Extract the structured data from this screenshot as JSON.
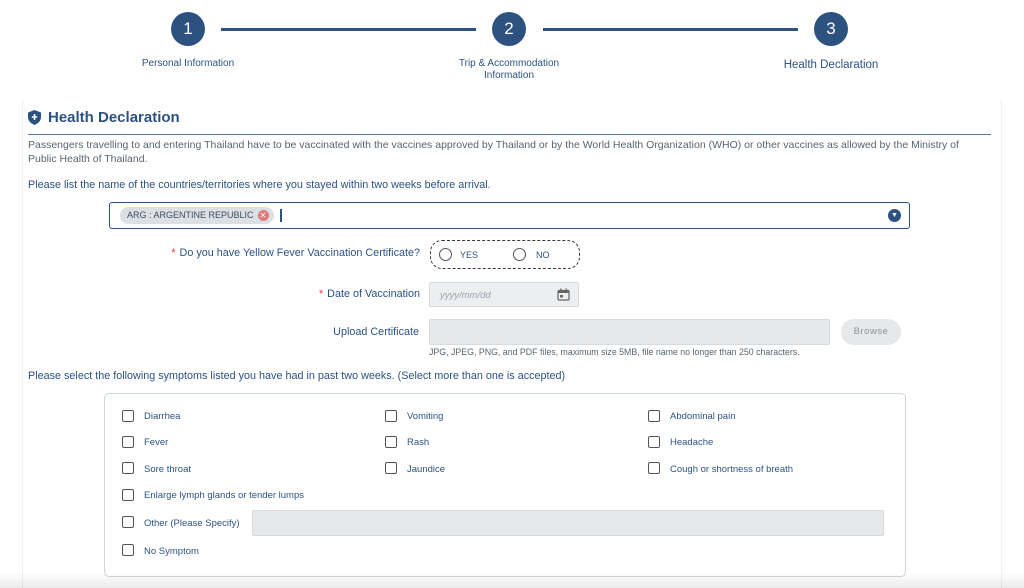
{
  "stepper": {
    "steps": [
      {
        "number": "1",
        "label": "Personal Information"
      },
      {
        "number": "2",
        "label_line1": "Trip & Accommodation",
        "label_line2": "Information"
      },
      {
        "number": "3",
        "label": "Health Declaration"
      }
    ],
    "active_step": 3
  },
  "section": {
    "icon": "shield-icon",
    "title": "Health Declaration",
    "intro": "Passengers travelling to and entering Thailand have to be vaccinated with the vaccines approved by Thailand or by the World Health Organization (WHO) or other vaccines as allowed by the Ministry of Public Health of Thailand."
  },
  "countries": {
    "question": "Please list the name of the countries/territories where you stayed within two weeks before arrival.",
    "selected": [
      "ARG : ARGENTINE REPUBLIC"
    ]
  },
  "yellow_fever": {
    "required_mark": "*",
    "question": "Do you have Yellow Fever Vaccination Certificate?",
    "options": [
      "YES",
      "NO"
    ],
    "selected": null
  },
  "vaccination_date": {
    "required_mark": "*",
    "label": "Date of Vaccination",
    "placeholder": "yyyy/mm/dd"
  },
  "upload": {
    "label": "Upload Certificate",
    "button": "Browse",
    "hint": "JPG, JPEG, PNG, and PDF files, maximum size 5MB, file name no longer than 250 characters."
  },
  "symptoms": {
    "question": "Please select the following symptoms listed you have had in past two weeks. (Select more than one is accepted)",
    "items": [
      "Diarrhea",
      "Vomiting",
      "Abdominal pain",
      "Fever",
      "Rash",
      "Headache",
      "Sore throat",
      "Jaundice",
      "Cough or shortness of breath",
      "Enlarge lymph glands or tender lumps",
      "Other (Please Specify)",
      "No Symptom"
    ],
    "checked": []
  },
  "colors": {
    "primary": "#2e5280",
    "required": "#e0393e",
    "chip_remove": "#e07a7a"
  }
}
